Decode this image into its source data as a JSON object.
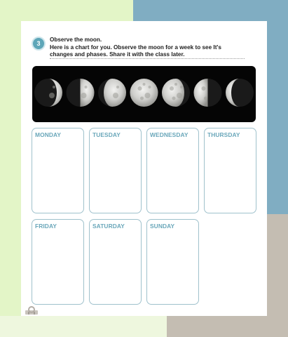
{
  "instruction": {
    "step_number": "3",
    "line1": "Observe the moon.",
    "line2": "Here is a chart for you. Observe the moon for a week to see It's",
    "line3": "changes and phases. Share it with the class later."
  },
  "moon_phases": [
    {
      "phase": "waxing-crescent",
      "lit_fraction": 0.2,
      "lit_side": "right"
    },
    {
      "phase": "first-quarter",
      "lit_fraction": 0.5,
      "lit_side": "right"
    },
    {
      "phase": "waxing-gibbous",
      "lit_fraction": 0.8,
      "lit_side": "right"
    },
    {
      "phase": "full-moon",
      "lit_fraction": 1.0,
      "lit_side": "both"
    },
    {
      "phase": "waning-gibbous",
      "lit_fraction": 0.8,
      "lit_side": "left"
    },
    {
      "phase": "last-quarter",
      "lit_fraction": 0.5,
      "lit_side": "left"
    },
    {
      "phase": "waning-crescent",
      "lit_fraction": 0.2,
      "lit_side": "left"
    }
  ],
  "days": {
    "monday": "MONDAY",
    "tuesday": "TUESDAY",
    "wednesday": "WEDNESDAY",
    "thursday": "THURSDAY",
    "friday": "FRIDAY",
    "saturday": "SATURDAY",
    "sunday": "SUNDAY"
  },
  "colors": {
    "accent": "#6aa7ba",
    "box_border": "#9fc1cc",
    "badge": "#5ea6b8",
    "bg_teal": "#80adc2",
    "bg_green": "#e3f5c7",
    "bg_gray": "#c4bdb2"
  }
}
